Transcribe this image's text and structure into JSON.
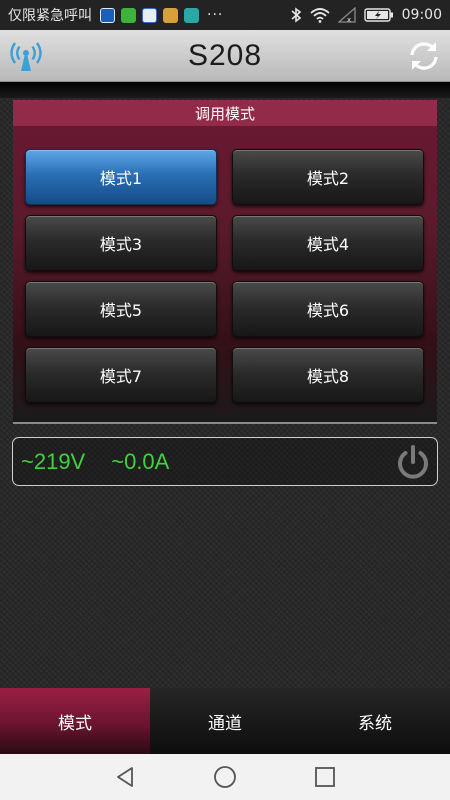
{
  "status_bar": {
    "carrier": "仅限紧急呼叫",
    "more": "···",
    "time": "09:00",
    "notification_icons": [
      "notification-icon",
      "notification-icon",
      "notification-icon",
      "notification-icon",
      "notification-icon"
    ],
    "notification_colors": [
      "#1b5fb5",
      "#3cb43c",
      "#3b6bd8",
      "#d6a03a",
      "#2aa7a7"
    ]
  },
  "header": {
    "title": "S208",
    "left_icon": "signal-antenna-icon",
    "right_icon": "refresh-icon",
    "accent": "#3aa0d8"
  },
  "panel": {
    "title": "调用模式",
    "modes": [
      {
        "label": "模式1",
        "active": true
      },
      {
        "label": "模式2",
        "active": false
      },
      {
        "label": "模式3",
        "active": false
      },
      {
        "label": "模式4",
        "active": false
      },
      {
        "label": "模式5",
        "active": false
      },
      {
        "label": "模式6",
        "active": false
      },
      {
        "label": "模式7",
        "active": false
      },
      {
        "label": "模式8",
        "active": false
      }
    ]
  },
  "readout": {
    "voltage": "~219V",
    "current": "~0.0A",
    "power_icon": "power-icon",
    "value_color": "#3fd23f"
  },
  "tabs": [
    {
      "label": "模式",
      "active": true
    },
    {
      "label": "通道",
      "active": false
    },
    {
      "label": "系统",
      "active": false
    }
  ],
  "nav": [
    "back-icon",
    "home-icon",
    "recents-icon"
  ]
}
